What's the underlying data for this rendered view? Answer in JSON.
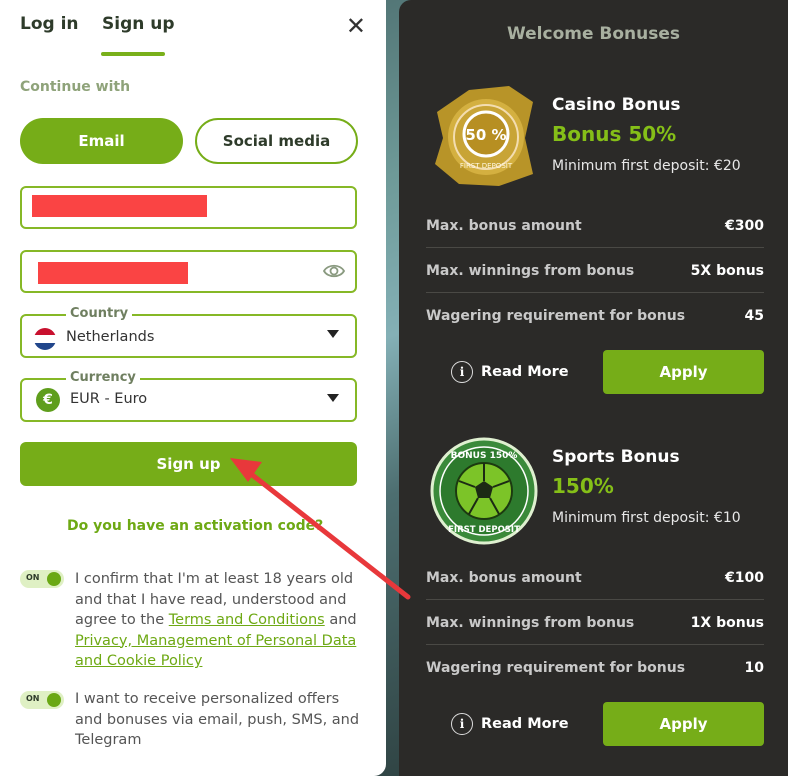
{
  "auth": {
    "tabs": {
      "login": "Log in",
      "signup": "Sign up"
    },
    "continue_with": "Continue with",
    "methods": {
      "email": "Email",
      "social": "Social media"
    },
    "country": {
      "legend": "Country",
      "value": "Netherlands"
    },
    "currency": {
      "legend": "Currency",
      "value": "EUR - Euro",
      "symbol": "€"
    },
    "submit_label": "Sign up",
    "activation_label": "Do you have an activation code?",
    "toggle_on": "ON",
    "consent_age": {
      "before": "I confirm that I'm at least 18 years old and that I have read, understood and agree to the ",
      "terms_link": "Terms and Conditions",
      "middle": " and ",
      "privacy_link": "Privacy, Management of Personal Data and Cookie Policy"
    },
    "consent_marketing": "I want to receive personalized offers and bonuses via email, push, SMS, and Telegram"
  },
  "bonuses": {
    "title": "Welcome Bonuses",
    "casino": {
      "badge_text": "50 %",
      "badge_ring": "FIRST DEPOSIT",
      "name": "Casino Bonus",
      "headline": "Bonus 50%",
      "min_deposit": "Minimum first deposit: €20",
      "rows": [
        {
          "label": "Max. bonus amount",
          "value": "€300"
        },
        {
          "label": "Max. winnings from bonus",
          "value": "5X bonus"
        },
        {
          "label": "Wagering requirement for bonus",
          "value": "45"
        }
      ],
      "read_more": "Read More",
      "apply": "Apply"
    },
    "sports": {
      "badge_top": "BONUS 150%",
      "badge_bottom": "FIRST DEPOSIT",
      "name": "Sports Bonus",
      "headline": "150%",
      "min_deposit": "Minimum first deposit: €10",
      "rows": [
        {
          "label": "Max. bonus amount",
          "value": "€100"
        },
        {
          "label": "Max. winnings from bonus",
          "value": "1X bonus"
        },
        {
          "label": "Wagering requirement for bonus",
          "value": "10"
        }
      ],
      "read_more": "Read More",
      "apply": "Apply"
    }
  },
  "colors": {
    "accent": "#76ad18",
    "panel": "#2b2a28",
    "annotation": "#e8383b"
  }
}
